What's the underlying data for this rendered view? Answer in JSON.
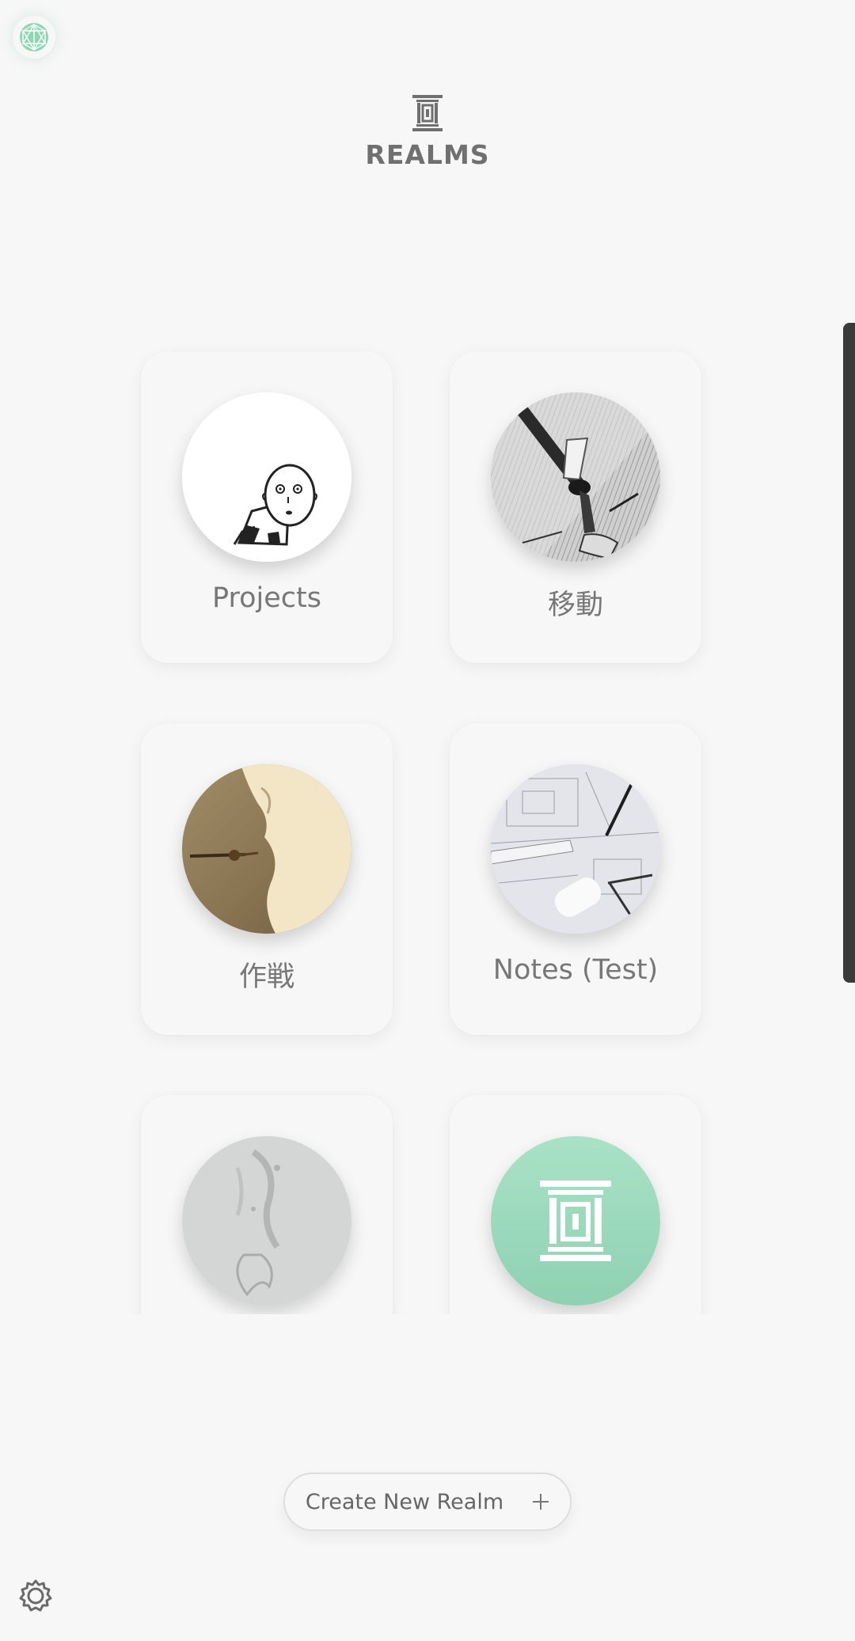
{
  "header": {
    "title": "REALMS",
    "logo_icon": "portal-pillar-icon"
  },
  "realms": [
    {
      "name": "Projects",
      "image": "bald-hero-sketch"
    },
    {
      "name": "移動",
      "image": "sword-manga-art"
    },
    {
      "name": "作戦",
      "image": "sepia-katana-painting"
    },
    {
      "name": "Notes (Test)",
      "image": "blueprints-drafting-tools"
    },
    {
      "name": "",
      "image": "faded-butterfly-sketch"
    },
    {
      "name": "",
      "image": "default-realm-pillar"
    }
  ],
  "actions": {
    "create_label": "Create New Realm",
    "create_icon": "plus-icon"
  },
  "icons": {
    "app_logo": "app-logo-icon",
    "settings": "gear-icon"
  },
  "colors": {
    "accent": "#8fd6b4",
    "text": "#777777",
    "background": "#f7f7f7"
  }
}
